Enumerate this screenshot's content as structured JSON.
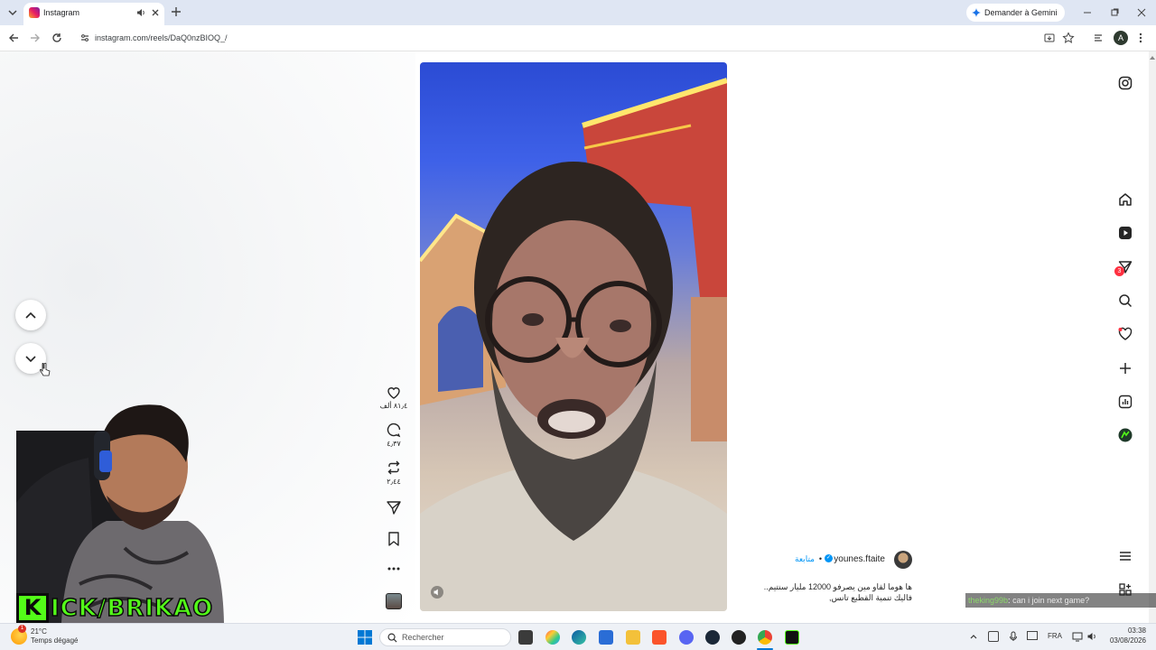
{
  "browser": {
    "tab_title": "Instagram",
    "url": "instagram.com/reels/DaQ0nzBIOQ_/",
    "gemini_label": "Demander à Gemini",
    "profile_initial": "A"
  },
  "reel": {
    "likes": "٨١٫٤ ألف",
    "comments": "٤٫٣٧",
    "reposts": "٢٫٤٤",
    "author_name": "younes.ftaite",
    "follow_label": "متابعة",
    "separator": "•",
    "caption_line1": "ها هوما لقاو مين يصرفو 12000 مليار سنتيم..",
    "caption_line2": "فاليك تنمية القطيع تانس,"
  },
  "sidebar": {
    "messages_badge": "3"
  },
  "stream": {
    "kick_text": "ICK/BRIKAO",
    "kick_logo_letter": "K",
    "chat_user": "theking99b",
    "chat_message": "can i join next game?"
  },
  "taskbar": {
    "search_placeholder": "Rechercher",
    "weather_temp": "21°C",
    "weather_desc": "Temps dégagé",
    "weather_badge": "1",
    "lang": "FRA",
    "time": "03:38",
    "date": "03/08/2026"
  },
  "colors": {
    "tab_strip": "#dfe6f3",
    "kick_green": "#53fc18",
    "instagram_blue": "#0095f6"
  }
}
